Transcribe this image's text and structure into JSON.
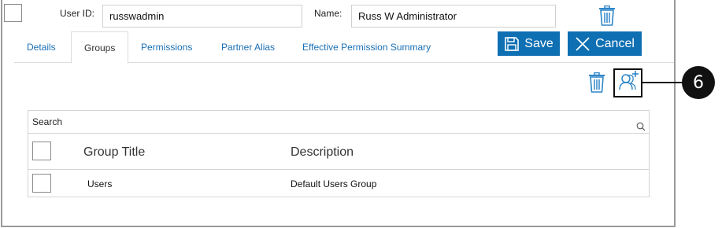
{
  "user": {
    "user_id_label": "User ID:",
    "user_id_value": "russwadmin",
    "name_label": "Name:",
    "name_value": "Russ W Administrator"
  },
  "tabs": [
    {
      "label": "Details",
      "active": false
    },
    {
      "label": "Groups",
      "active": true
    },
    {
      "label": "Permissions",
      "active": false
    },
    {
      "label": "Partner Alias",
      "active": false
    },
    {
      "label": "Effective Permission Summary",
      "active": false
    }
  ],
  "actions": {
    "save_label": "Save",
    "cancel_label": "Cancel"
  },
  "callout": {
    "number": "6"
  },
  "grid": {
    "search_placeholder": "Search",
    "columns": [
      "Group Title",
      "Description"
    ],
    "rows": [
      {
        "title": "Users",
        "description": "Default Users Group"
      }
    ]
  },
  "colors": {
    "accent": "#0f6fb3",
    "link": "#1a6fb5",
    "icon": "#2f86c8"
  },
  "icons": [
    "trash-icon",
    "floppy-disk-icon",
    "close-x-icon",
    "add-user-icon",
    "search-icon"
  ]
}
